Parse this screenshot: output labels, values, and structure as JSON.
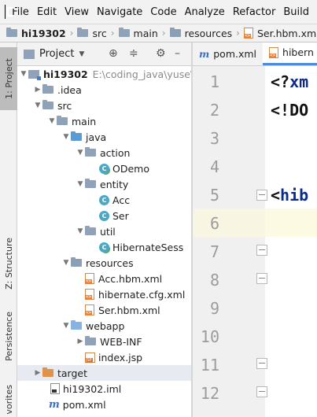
{
  "menu": [
    "File",
    "Edit",
    "View",
    "Navigate",
    "Code",
    "Analyze",
    "Refactor",
    "Build"
  ],
  "breadcrumb": [
    "hi19302",
    "src",
    "main",
    "resources",
    "Ser.hbm.xml"
  ],
  "left_stripe": {
    "project_tab": "1: Project",
    "structure_tab": "Z: Structure",
    "persistence_tab": "Persistence",
    "favorites_tab": "vorites"
  },
  "project_panel": {
    "title": "Project"
  },
  "tree": [
    {
      "label": "hi19302",
      "extra": "E:\\coding_java\\yuse\\hi"
    },
    {
      "label": ".idea"
    },
    {
      "label": "src"
    },
    {
      "label": "main"
    },
    {
      "label": "java"
    },
    {
      "label": "action"
    },
    {
      "label": "ODemo"
    },
    {
      "label": "entity"
    },
    {
      "label": "Acc"
    },
    {
      "label": "Ser"
    },
    {
      "label": "util"
    },
    {
      "label": "HibernateSess"
    },
    {
      "label": "resources"
    },
    {
      "label": "Acc.hbm.xml"
    },
    {
      "label": "hibernate.cfg.xml"
    },
    {
      "label": "Ser.hbm.xml"
    },
    {
      "label": "webapp"
    },
    {
      "label": "WEB-INF"
    },
    {
      "label": "index.jsp"
    },
    {
      "label": "target"
    },
    {
      "label": "hi19302.iml"
    },
    {
      "label": "pom.xml"
    }
  ],
  "editor": {
    "tabs": [
      "pom.xml",
      "hibern"
    ],
    "line_numbers": [
      "1",
      "2",
      "3",
      "4",
      "5",
      "6",
      "7",
      "8",
      "9",
      "10",
      "11",
      "12"
    ],
    "code": {
      "line1_a": "<?",
      "line1_b": "xm",
      "line2": "<!DO",
      "line5_a": "<",
      "line5_b": "hib"
    }
  }
}
